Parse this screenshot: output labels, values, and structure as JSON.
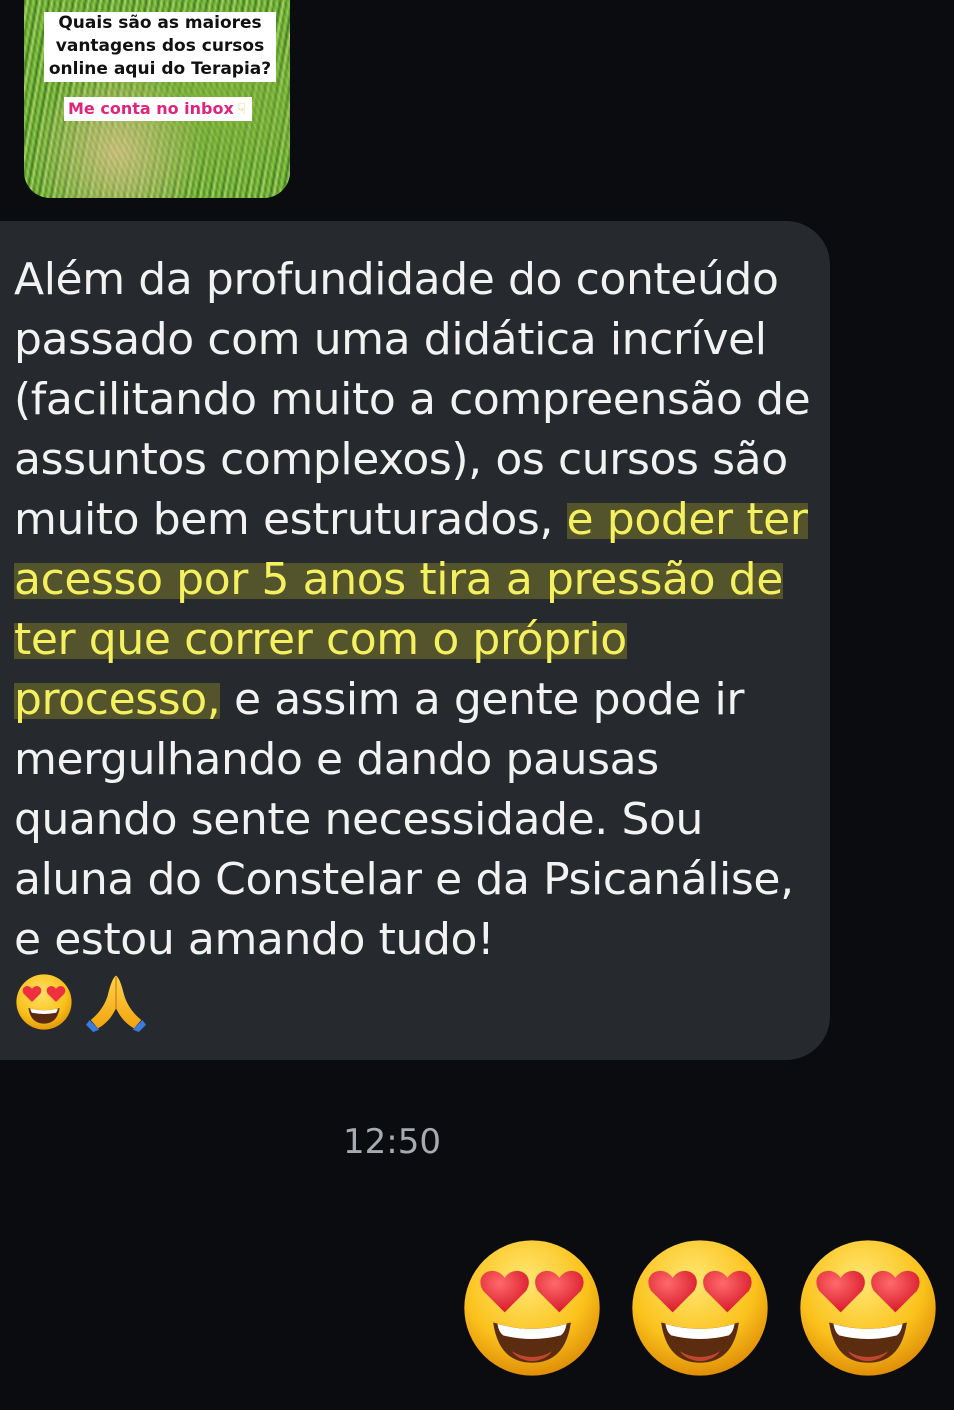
{
  "story": {
    "question": "Quais são as maiores vantagens dos cursos online aqui do Terapia?",
    "cta": "Me conta no inbox",
    "cta_icon": "pointing-down-finger-icon"
  },
  "message": {
    "before_highlight": "Além da profundidade do conteúdo passado com uma didática incrível (facilitando muito a compreensão de assuntos complexos), os cursos são muito bem estruturados, ",
    "highlight": "e poder ter acesso por 5 anos tira a pressão de ter que correr com o próprio processo,",
    "after_highlight": " e assim a gente pode ir mergulhando e dando pausas quando sente necessidade. Sou aluna do Constelar e da Psicanálise,  e estou amando tudo!",
    "emojis": [
      "smiling-face-with-heart-eyes-icon",
      "folded-hands-icon"
    ]
  },
  "timestamp": "12:50",
  "reply": {
    "emojis": [
      "smiling-face-with-heart-eyes-icon",
      "smiling-face-with-heart-eyes-icon",
      "smiling-face-with-heart-eyes-icon"
    ]
  },
  "colors": {
    "background": "#0b0c0f",
    "bubble": "#262a2f",
    "text": "#f2f2f2",
    "highlight_text": "#f4f060",
    "timestamp": "#a7abb1",
    "cta_text": "#e0247b"
  }
}
